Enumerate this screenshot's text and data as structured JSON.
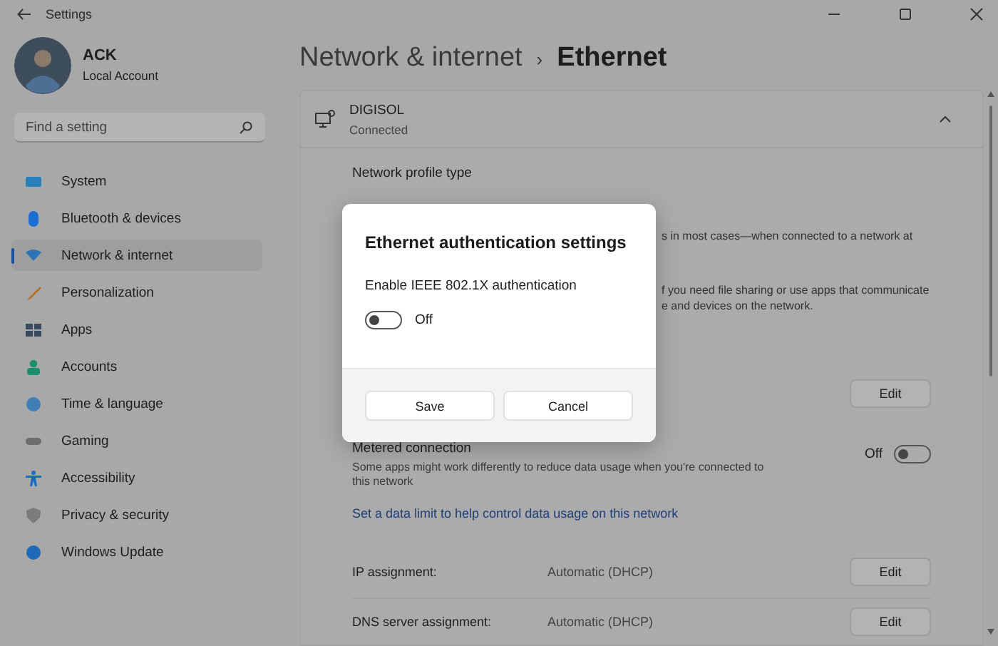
{
  "window": {
    "title": "Settings"
  },
  "profile": {
    "name": "ACK",
    "account": "Local Account"
  },
  "search": {
    "placeholder": "Find a setting"
  },
  "nav": [
    {
      "label": "System",
      "selected": false
    },
    {
      "label": "Bluetooth & devices",
      "selected": false
    },
    {
      "label": "Network & internet",
      "selected": true
    },
    {
      "label": "Personalization",
      "selected": false
    },
    {
      "label": "Apps",
      "selected": false
    },
    {
      "label": "Accounts",
      "selected": false
    },
    {
      "label": "Time & language",
      "selected": false
    },
    {
      "label": "Gaming",
      "selected": false
    },
    {
      "label": "Accessibility",
      "selected": false
    },
    {
      "label": "Privacy & security",
      "selected": false
    },
    {
      "label": "Windows Update",
      "selected": false
    }
  ],
  "breadcrumb": {
    "parent": "Network & internet",
    "separator": "›",
    "current": "Ethernet"
  },
  "connection": {
    "name": "DIGISOL",
    "status": "Connected",
    "expanded": true
  },
  "profile_type": {
    "label": "Network profile type",
    "covered_lines": [
      "s in most cases—when connected to a network at",
      "f you need file sharing or use apps that communicate",
      "e and devices on the network."
    ],
    "button": "Edit"
  },
  "metered": {
    "title": "Metered connection",
    "description": "Some apps might work differently to reduce data usage when you're connected to this network",
    "state_label": "Off",
    "on": false
  },
  "data_limit_link": "Set a data limit to help control data usage on this network",
  "settings": [
    {
      "label": "IP assignment:",
      "value": "Automatic (DHCP)",
      "button": "Edit"
    },
    {
      "label": "DNS server assignment:",
      "value": "Automatic (DHCP)",
      "button": "Edit"
    }
  ],
  "dialog": {
    "title": "Ethernet authentication settings",
    "option": "Enable IEEE 802.1X authentication",
    "on": false,
    "state_label": "Off",
    "buttons": [
      "Save",
      "Cancel"
    ]
  }
}
